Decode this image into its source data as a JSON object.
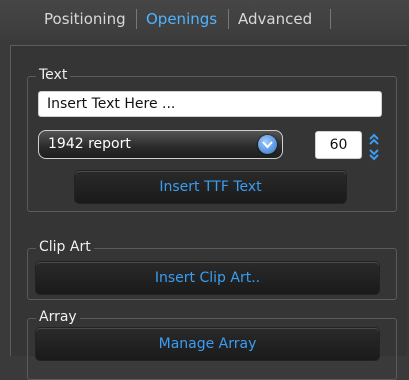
{
  "tabs": [
    {
      "label": "Positioning"
    },
    {
      "label": "Openings"
    },
    {
      "label": "Advanced"
    }
  ],
  "active_tab": "Openings",
  "text_group": {
    "legend": "Text",
    "text_input_value": "Insert Text Here ...",
    "font_select_value": "1942 report",
    "size_value": "60",
    "insert_button_label": "Insert TTF Text"
  },
  "clipart_group": {
    "legend": "Clip Art",
    "insert_button_label": "Insert Clip Art.."
  },
  "array_group": {
    "legend": "Array",
    "manage_button_label": "Manage Array"
  },
  "colors": {
    "accent": "#4fb3ff",
    "background": "#3a3a3a",
    "button_text": "#3a9df2"
  },
  "icons": {
    "dropdown": "chevron-down-icon",
    "spinner_up": "chevron-up-icon",
    "spinner_down": "chevron-down-icon"
  }
}
